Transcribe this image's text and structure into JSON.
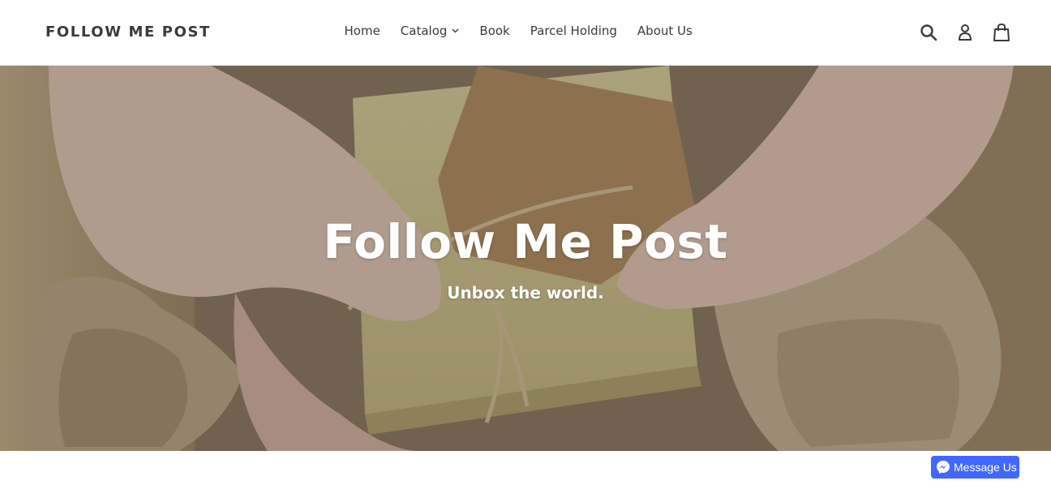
{
  "header": {
    "logo": "FOLLOW ME POST",
    "nav": [
      {
        "label": "Home"
      },
      {
        "label": "Catalog",
        "has_dropdown": true
      },
      {
        "label": "Book"
      },
      {
        "label": "Parcel Holding"
      },
      {
        "label": "About Us"
      }
    ],
    "icons": [
      "search-icon",
      "account-icon",
      "cart-icon"
    ]
  },
  "hero": {
    "title": "Follow Me Post",
    "subtitle": "Unbox the world."
  },
  "messenger": {
    "label": "Message Us",
    "icon": "messenger-icon",
    "color": "#4267ff"
  }
}
